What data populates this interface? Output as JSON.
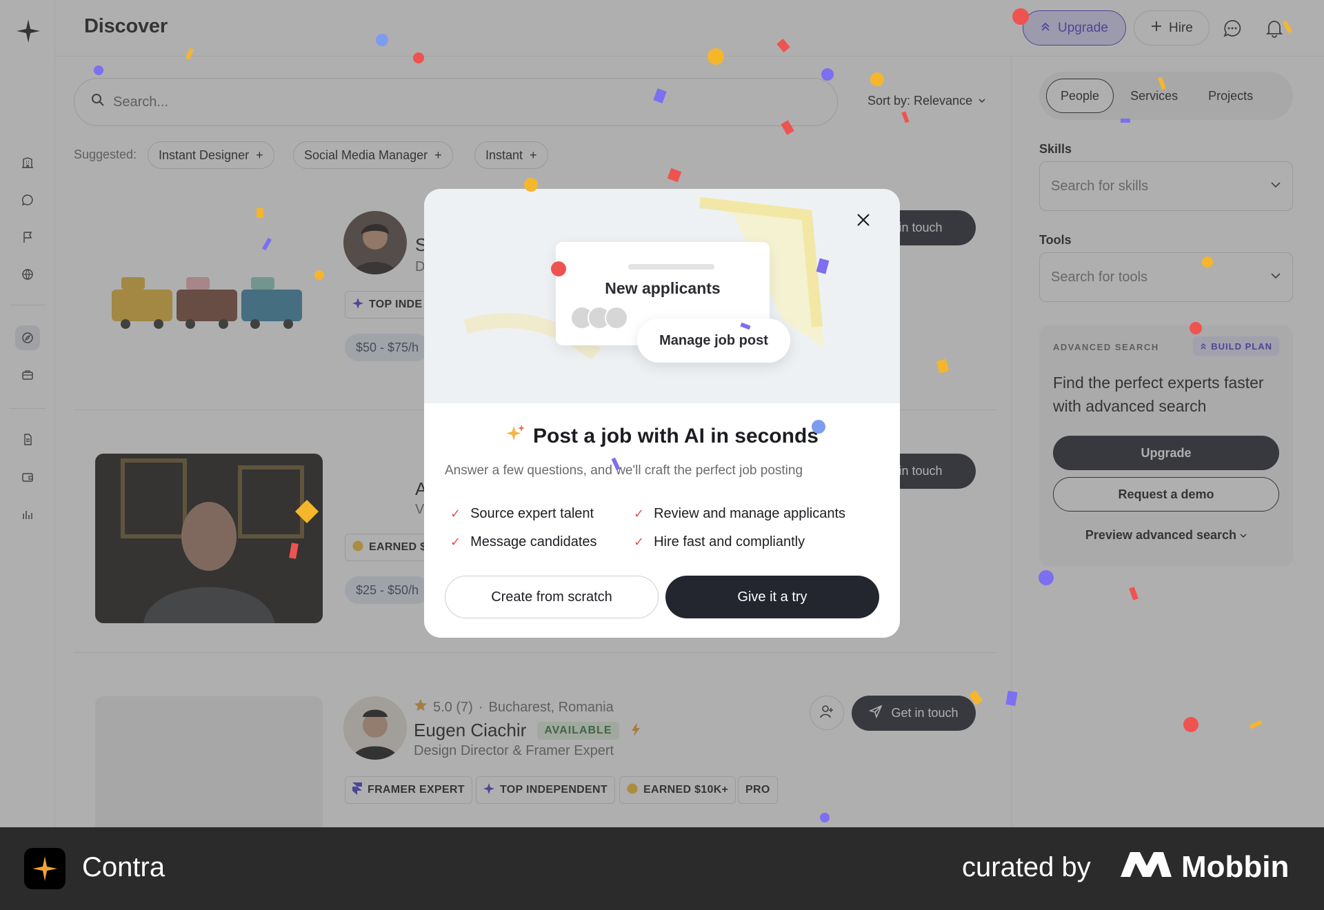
{
  "header": {
    "title": "Discover",
    "upgrade_label": "Upgrade",
    "hire_label": "Hire"
  },
  "search": {
    "placeholder": "Search..."
  },
  "sort": {
    "label": "Sort by: Relevance"
  },
  "suggested": {
    "label": "Suggested:",
    "chips": [
      "Instant Designer",
      "Social Media Manager",
      "Instant"
    ]
  },
  "cards": [
    {
      "name_initial": "S",
      "role_initial": "D",
      "badge": "TOP INDE",
      "rate": "$50 - $75/h",
      "contact_label": "et in touch"
    },
    {
      "name_initial": "A",
      "role_initial": "V",
      "badge": "EARNED $",
      "rate": "$25 - $50/h",
      "contact_label": "et in touch"
    },
    {
      "rating": "5.0 (7)",
      "location": "Bucharest, Romania",
      "name": "Eugen Ciachir",
      "availability": "AVAILABLE",
      "role": "Design Director & Framer Expert",
      "badges": [
        "FRAMER EXPERT",
        "TOP INDEPENDENT",
        "EARNED $10K+",
        "PRO"
      ],
      "contact_label": "Get in touch"
    }
  ],
  "right_panel": {
    "tabs": [
      "People",
      "Services",
      "Projects"
    ],
    "skills_label": "Skills",
    "skills_placeholder": "Search for skills",
    "tools_label": "Tools",
    "tools_placeholder": "Search for tools",
    "advanced": {
      "kicker": "ADVANCED SEARCH",
      "plan": "BUILD PLAN",
      "title": "Find the perfect experts faster with advanced search",
      "primary": "Upgrade",
      "secondary": "Request a demo",
      "preview": "Preview advanced search"
    }
  },
  "modal": {
    "hero_card_title": "New applicants",
    "hero_button": "Manage job post",
    "title": "Post a job with AI in seconds",
    "subtitle": "Answer a few questions, and we'll craft the perfect job posting",
    "features": [
      "Source expert talent",
      "Review and manage applicants",
      "Message candidates",
      "Hire fast and compliantly"
    ],
    "secondary_button": "Create from scratch",
    "primary_button": "Give it a try"
  },
  "footer": {
    "app_name": "Contra",
    "curated_by": "curated by",
    "brand": "Mobbin"
  },
  "colors": {
    "accent": "#4b3bd0",
    "dark": "#23252f",
    "available_green": "#2f7a3a"
  }
}
